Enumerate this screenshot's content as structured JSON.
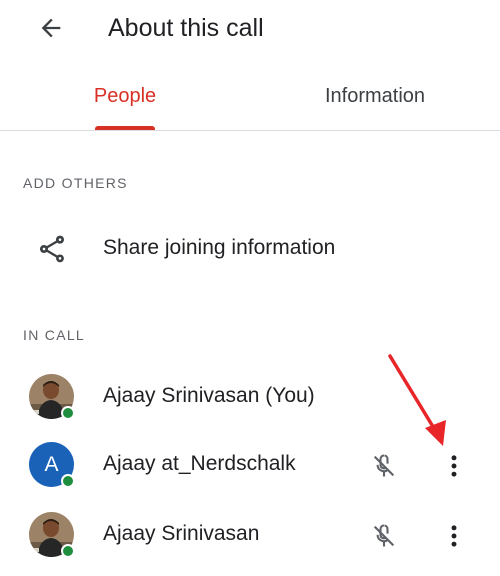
{
  "header": {
    "title": "About this call",
    "back_icon": "arrow-back-icon"
  },
  "tabs": [
    {
      "label": "People",
      "active": true
    },
    {
      "label": "Information",
      "active": false
    }
  ],
  "add_others": {
    "section_label": "ADD OTHERS",
    "share_label": "Share joining information",
    "share_icon": "share-icon"
  },
  "in_call": {
    "section_label": "IN CALL",
    "participants": [
      {
        "name": "Ajaay Srinivasan (You)",
        "avatar": "photo",
        "online": true,
        "show_controls": false
      },
      {
        "name": "Ajaay at_Nerdschalk",
        "avatar": "A",
        "online": true,
        "show_controls": true
      },
      {
        "name": "Ajaay Srinivasan",
        "avatar": "photo",
        "online": true,
        "show_controls": true
      }
    ]
  },
  "colors": {
    "accent": "#d93025",
    "online": "#1e8e3e",
    "avatar_blue": "#1a62b8",
    "annotation_arrow": "#e8262a"
  }
}
